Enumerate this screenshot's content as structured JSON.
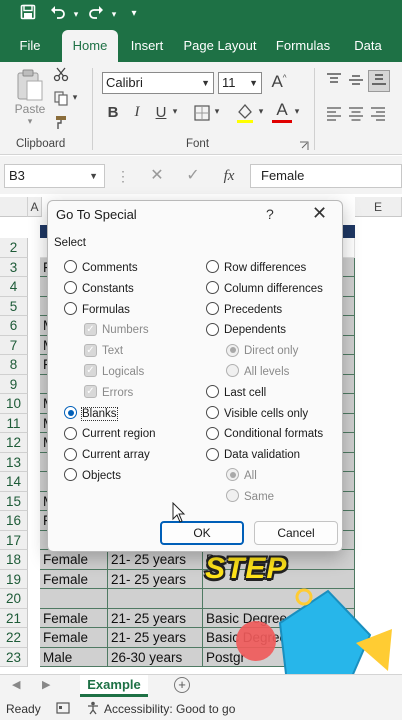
{
  "ribbon": {
    "tabs": [
      "File",
      "Home",
      "Insert",
      "Page Layout",
      "Formulas",
      "Data"
    ],
    "active_tab": "Home",
    "paste_label": "Paste",
    "clipboard_label": "Clipboard",
    "font_label": "Font",
    "font_name": "Calibri",
    "font_size": "11",
    "bold": "B",
    "italic": "I",
    "underline": "U",
    "grow_font": "A",
    "font_color_letter": "A"
  },
  "formula_bar": {
    "name_box": "B3",
    "fx": "fx",
    "content": "Female"
  },
  "grid": {
    "col_a": "A",
    "col_e": "E",
    "rows": [
      {
        "n": "2",
        "a": "",
        "b": "",
        "c": "",
        "d": ""
      },
      {
        "n": "3",
        "a": "F",
        "b": "",
        "c": "",
        "d": ""
      },
      {
        "n": "4",
        "a": "",
        "b": "",
        "c": "",
        "d": ""
      },
      {
        "n": "5",
        "a": "",
        "b": "",
        "c": "",
        "d": ""
      },
      {
        "n": "6",
        "a": "M",
        "b": "",
        "c": "",
        "d": ""
      },
      {
        "n": "7",
        "a": "M",
        "b": "",
        "c": "",
        "d": ""
      },
      {
        "n": "8",
        "a": "F",
        "b": "",
        "c": "",
        "d": ""
      },
      {
        "n": "9",
        "a": "",
        "b": "",
        "c": "",
        "d": ""
      },
      {
        "n": "10",
        "a": "M",
        "b": "",
        "c": "",
        "d": ""
      },
      {
        "n": "11",
        "a": "M",
        "b": "",
        "c": "",
        "d": ""
      },
      {
        "n": "12",
        "a": "M",
        "b": "",
        "c": "",
        "d": ""
      },
      {
        "n": "13",
        "a": "",
        "b": "",
        "c": "",
        "d": ""
      },
      {
        "n": "14",
        "a": "",
        "b": "",
        "c": "",
        "d": ""
      },
      {
        "n": "15",
        "a": "M",
        "b": "",
        "c": "",
        "d": ""
      },
      {
        "n": "16",
        "a": "F",
        "b": "",
        "c": "",
        "d": ""
      },
      {
        "n": "17",
        "a": "",
        "b": "",
        "c": "",
        "d": ""
      },
      {
        "n": "18",
        "a": "Female",
        "b": "21- 25 years",
        "c": "B",
        "d": ""
      },
      {
        "n": "19",
        "a": "Female",
        "b": "21- 25 years",
        "c": "",
        "d": ""
      },
      {
        "n": "20",
        "a": "",
        "b": "",
        "c": "",
        "d": ""
      },
      {
        "n": "21",
        "a": "Female",
        "b": "21- 25 years",
        "c": "Basic Degree",
        "d": ""
      },
      {
        "n": "22",
        "a": "Female",
        "b": "21- 25 years",
        "c": "Basic Degree",
        "d": ""
      },
      {
        "n": "23",
        "a": "Male",
        "b": "26-30 years",
        "c": "Postgr",
        "d": ""
      }
    ]
  },
  "sheet_tab": "Example",
  "status": {
    "ready": "Ready",
    "accessibility": "Accessibility: Good to go"
  },
  "overlay_text": "STEP",
  "dialog": {
    "title": "Go To Special",
    "help": "?",
    "section_label": "Select",
    "left": [
      {
        "label": "Comments",
        "type": "radio",
        "disabled": false,
        "checked": false,
        "indent": false
      },
      {
        "label": "Constants",
        "type": "radio",
        "disabled": false,
        "checked": false,
        "indent": false
      },
      {
        "label": "Formulas",
        "type": "radio",
        "disabled": false,
        "checked": false,
        "indent": false
      },
      {
        "label": "Numbers",
        "type": "check",
        "disabled": true,
        "checked": true,
        "indent": true
      },
      {
        "label": "Text",
        "type": "check",
        "disabled": true,
        "checked": true,
        "indent": true
      },
      {
        "label": "Logicals",
        "type": "check",
        "disabled": true,
        "checked": true,
        "indent": true
      },
      {
        "label": "Errors",
        "type": "check",
        "disabled": true,
        "checked": true,
        "indent": true
      },
      {
        "label": "Blanks",
        "type": "radio",
        "disabled": false,
        "checked": true,
        "indent": false
      },
      {
        "label": "Current region",
        "type": "radio",
        "disabled": false,
        "checked": false,
        "indent": false
      },
      {
        "label": "Current array",
        "type": "radio",
        "disabled": false,
        "checked": false,
        "indent": false
      },
      {
        "label": "Objects",
        "type": "radio",
        "disabled": false,
        "checked": false,
        "indent": false
      }
    ],
    "right": [
      {
        "label": "Row differences",
        "type": "radio",
        "disabled": false,
        "checked": false,
        "indent": false
      },
      {
        "label": "Column differences",
        "type": "radio",
        "disabled": false,
        "checked": false,
        "indent": false
      },
      {
        "label": "Precedents",
        "type": "radio",
        "disabled": false,
        "checked": false,
        "indent": false
      },
      {
        "label": "Dependents",
        "type": "radio",
        "disabled": false,
        "checked": false,
        "indent": false
      },
      {
        "label": "Direct only",
        "type": "radio",
        "disabled": true,
        "checked": true,
        "indent": true
      },
      {
        "label": "All levels",
        "type": "radio",
        "disabled": true,
        "checked": false,
        "indent": true
      },
      {
        "label": "Last cell",
        "type": "radio",
        "disabled": false,
        "checked": false,
        "indent": false
      },
      {
        "label": "Visible cells only",
        "type": "radio",
        "disabled": false,
        "checked": false,
        "indent": false
      },
      {
        "label": "Conditional formats",
        "type": "radio",
        "disabled": false,
        "checked": false,
        "indent": false
      },
      {
        "label": "Data validation",
        "type": "radio",
        "disabled": false,
        "checked": false,
        "indent": false
      },
      {
        "label": "All",
        "type": "radio",
        "disabled": true,
        "checked": true,
        "indent": true
      },
      {
        "label": "Same",
        "type": "radio",
        "disabled": true,
        "checked": false,
        "indent": true
      }
    ],
    "ok_label": "OK",
    "cancel_label": "Cancel"
  }
}
